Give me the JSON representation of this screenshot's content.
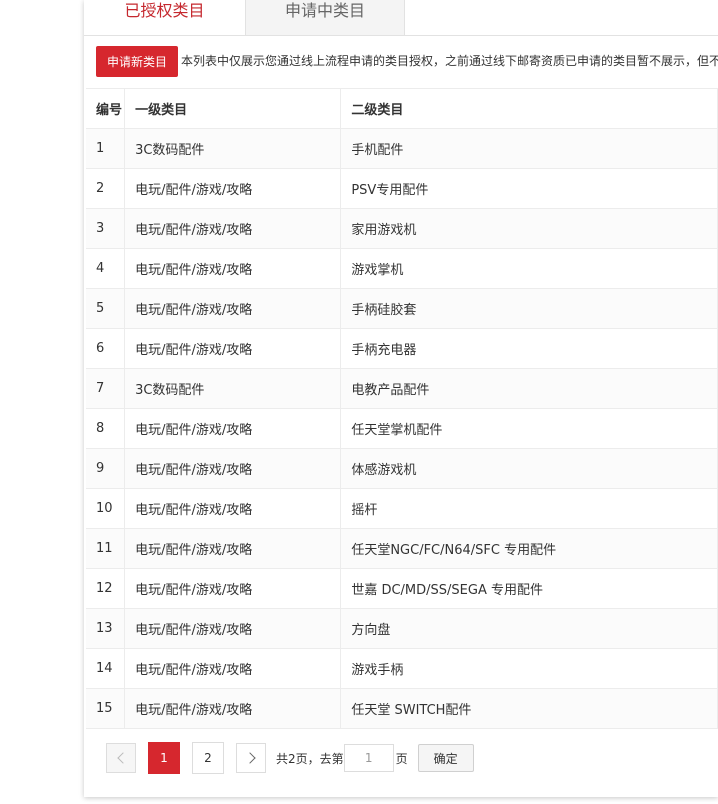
{
  "tabs": [
    {
      "label": "已授权类目",
      "active": true
    },
    {
      "label": "申请中类目",
      "active": false
    }
  ],
  "toolbar": {
    "apply_label": "申请新类目",
    "notice": "本列表中仅展示您通过线上流程申请的类目授权，之前通过线下邮寄资质已申请的类目暂不展示，但不"
  },
  "table": {
    "headers": {
      "no": "编号",
      "level1": "一级类目",
      "level2": "二级类目"
    },
    "rows": [
      {
        "no": "1",
        "level1": "3C数码配件",
        "level2": "手机配件"
      },
      {
        "no": "2",
        "level1": "电玩/配件/游戏/攻略",
        "level2": "PSV专用配件"
      },
      {
        "no": "3",
        "level1": "电玩/配件/游戏/攻略",
        "level2": "家用游戏机"
      },
      {
        "no": "4",
        "level1": "电玩/配件/游戏/攻略",
        "level2": "游戏掌机"
      },
      {
        "no": "5",
        "level1": "电玩/配件/游戏/攻略",
        "level2": "手柄硅胶套"
      },
      {
        "no": "6",
        "level1": "电玩/配件/游戏/攻略",
        "level2": "手柄充电器"
      },
      {
        "no": "7",
        "level1": "3C数码配件",
        "level2": "电教产品配件"
      },
      {
        "no": "8",
        "level1": "电玩/配件/游戏/攻略",
        "level2": "任天堂掌机配件"
      },
      {
        "no": "9",
        "level1": "电玩/配件/游戏/攻略",
        "level2": "体感游戏机"
      },
      {
        "no": "10",
        "level1": "电玩/配件/游戏/攻略",
        "level2": "摇杆"
      },
      {
        "no": "11",
        "level1": "电玩/配件/游戏/攻略",
        "level2": "任天堂NGC/FC/N64/SFC 专用配件"
      },
      {
        "no": "12",
        "level1": "电玩/配件/游戏/攻略",
        "level2": "世嘉 DC/MD/SS/SEGA 专用配件"
      },
      {
        "no": "13",
        "level1": "电玩/配件/游戏/攻略",
        "level2": "方向盘"
      },
      {
        "no": "14",
        "level1": "电玩/配件/游戏/攻略",
        "level2": "游戏手柄"
      },
      {
        "no": "15",
        "level1": "电玩/配件/游戏/攻略",
        "level2": "任天堂 SWITCH配件"
      }
    ]
  },
  "pagination": {
    "pages": [
      "1",
      "2"
    ],
    "current": "1",
    "total_text": "共2页，去第",
    "goto_value": "1",
    "page_suffix": "页",
    "confirm_label": "确定",
    "prev_icon": "chevron-left-icon",
    "next_icon": "chevron-right-icon"
  },
  "colors": {
    "accent": "#d6272e",
    "active_tab_text": "#c5282e"
  }
}
